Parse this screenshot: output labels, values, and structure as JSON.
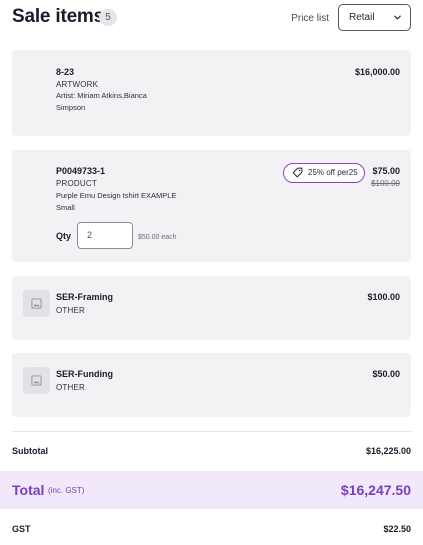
{
  "header": {
    "title": "Sale items",
    "count": "5",
    "price_list_label": "Price list",
    "price_list_value": "Retail"
  },
  "items": [
    {
      "sku": "8-23",
      "type": "ARTWORK",
      "description": "Artist: Miriam Atkins,Bianca Simpson",
      "price": "$16,000.00"
    },
    {
      "sku": "P0049733-1",
      "type": "PRODUCT",
      "description_line1": "Purple Emu Design tshirt EXAMPLE",
      "description_line2": "Small",
      "promo": "25% off per25",
      "price": "$75.00",
      "old_price": "$100.00",
      "qty_label": "Qty",
      "qty_value": "2",
      "each": "$50.00 each"
    },
    {
      "sku": "SER-Framing",
      "type": "OTHER",
      "price": "$100.00",
      "thumb_icon": "image-placeholder-icon"
    },
    {
      "sku": "SER-Funding",
      "type": "OTHER",
      "price": "$50.00",
      "thumb_icon": "image-placeholder-icon"
    }
  ],
  "summary": {
    "subtotal_label": "Subtotal",
    "subtotal_value": "$16,225.00",
    "total_label": "Total",
    "total_note": "(inc. GST)",
    "total_value": "$16,247.50",
    "gst_label": "GST",
    "gst_value": "$22.50"
  },
  "colors": {
    "accent": "#7b3ec2",
    "promo_border": "#8a44c8",
    "card_bg": "#f2f2f4",
    "total_bg": "#f1e9fa"
  }
}
